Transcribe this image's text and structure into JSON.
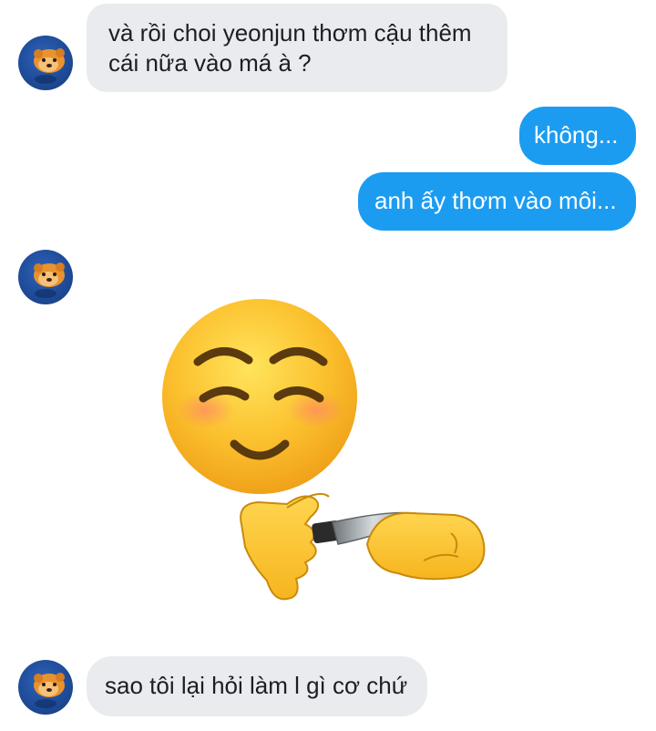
{
  "conversation": {
    "messages": [
      {
        "sender": "other",
        "lines": [
          "và rồi choi yeonjun thơm cậu thêm",
          "cái nữa vào má à ?"
        ]
      },
      {
        "sender": "me",
        "lines": [
          "không..."
        ]
      },
      {
        "sender": "me",
        "lines": [
          "anh ấy thơm vào môi..."
        ]
      },
      {
        "sender": "other",
        "type": "sticker",
        "icon": "blushing-face-with-knife-sticker"
      },
      {
        "sender": "other",
        "lines": [
          "sao tôi lại hỏi làm l gì cơ chứ"
        ]
      }
    ]
  },
  "colors": {
    "incoming_bubble": "#e9ebee",
    "outgoing_bubble": "#1b9cf0",
    "incoming_text": "#1c1e21",
    "outgoing_text": "#ffffff",
    "avatar_bg": "#1f4c9a"
  }
}
